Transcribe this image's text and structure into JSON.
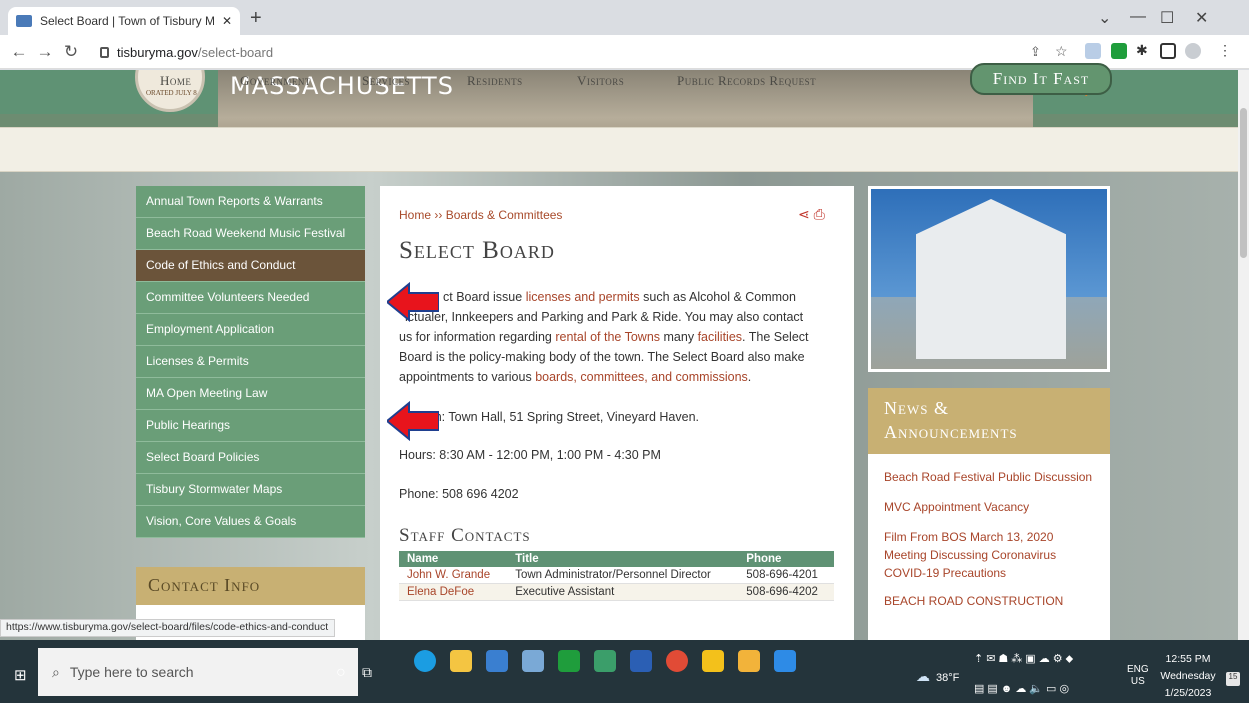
{
  "browser": {
    "tab_title": "Select Board | Town of Tisbury M",
    "url_host": "tisburyma.gov",
    "url_path": "/select-board",
    "status_url": "https://www.tisburyma.gov/select-board/files/code-ethics-and-conduct"
  },
  "header": {
    "seal_text": "ORATED JULY 8",
    "state": "MASSACHUSETTS"
  },
  "menu": {
    "items": [
      "Home",
      "Government",
      "Services",
      "Residents",
      "Visitors",
      "Public Records Request"
    ],
    "find_it_fast": "Find It Fast"
  },
  "sidebar": {
    "items": [
      "Annual Town Reports & Warrants",
      "Beach Road Weekend Music Festival",
      "Code of Ethics and Conduct",
      "Committee Volunteers Needed",
      "Employment Application",
      "Licenses & Permits",
      "MA Open Meeting Law",
      "Public Hearings",
      "Select Board Policies",
      "Tisbury Stormwater Maps",
      "Vision, Core Values & Goals"
    ],
    "active_index": 2,
    "contact_heading": "Contact Info"
  },
  "main": {
    "breadcrumb_home": "Home",
    "breadcrumb_sep": "››",
    "breadcrumb_section": "Boards & Committees",
    "title": "Select Board",
    "intro_a": "ct Board issue ",
    "intro_link1": "licenses and permits",
    "intro_b": " such as Alcohol & Common",
    "intro_c": "ictualer, Innkeepers and Parking and Park & Ride.  You may also contact",
    "intro_d": "us for information regarding ",
    "intro_link2": "rental of the Towns",
    "intro_e": " many ",
    "intro_link3": "facilities",
    "intro_f": ". The Select",
    "intro_g": "Board is the policy-making body of the town.  The Select Board also make",
    "intro_h": "appointments to various ",
    "intro_link4": "boards, committees, and commissions",
    "intro_i": ".",
    "location": "ion: Town Hall, 51 Spring Street, Vineyard Haven.",
    "hours": "Hours: 8:30 AM - 12:00 PM, 1:00 PM - 4:30 PM",
    "phone": "Phone: 508 696 4202",
    "staff_heading": "Staff Contacts",
    "staff_columns": [
      "Name",
      "Title",
      "Phone"
    ],
    "staff_rows": [
      [
        "John W. Grande",
        "Town Administrator/Personnel Director",
        "508-696-4201"
      ],
      [
        "Elena DeFoe",
        "Executive Assistant",
        "508-696-4202"
      ]
    ]
  },
  "news": {
    "heading_line1": "News &",
    "heading_line2": "Announcements",
    "items": [
      "Beach Road Festival Public Discussion",
      "MVC Appointment Vacancy",
      "Film From BOS March 13, 2020 Meeting Discussing Coronavirus COVID-19 Precautions",
      "BEACH ROAD CONSTRUCTION"
    ]
  },
  "taskbar": {
    "search_placeholder": "Type here to search",
    "temperature": "38°F",
    "lang1": "ENG",
    "lang2": "US",
    "time": "12:55 PM",
    "day": "Wednesday",
    "date": "1/25/2023",
    "notifications": "15"
  },
  "colors": {
    "green": "#6a9e78",
    "brown_active": "#6b543a",
    "tan": "#c8b073",
    "link": "#a8452a",
    "arrow": "#e8141c"
  }
}
